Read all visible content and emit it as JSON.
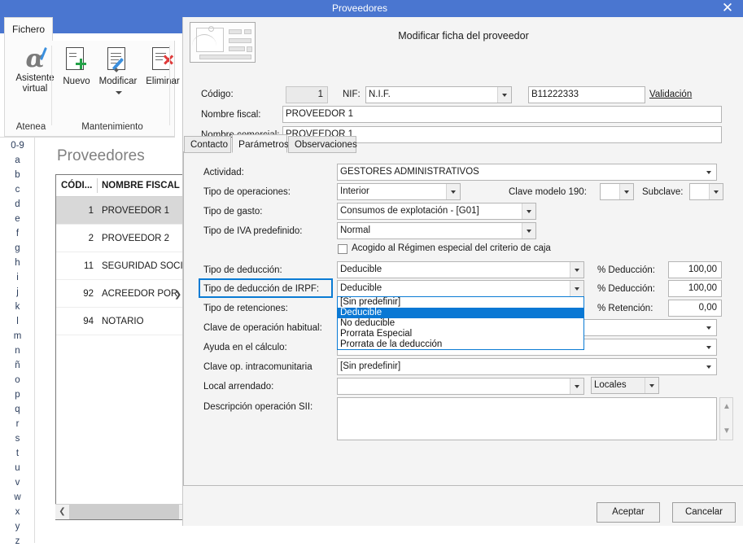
{
  "window": {
    "title": "Proveedores",
    "close_label": "✕"
  },
  "ribbon": {
    "tab_label": "Fichero",
    "buttons": [
      {
        "label_line1": "Asistente",
        "label_line2": "virtual",
        "icon": "alpha-pen-icon"
      },
      {
        "label": "Nuevo",
        "icon": "document-plus-icon"
      },
      {
        "label": "Modificar",
        "icon": "document-pencil-icon"
      },
      {
        "label": "Eliminar",
        "icon": "document-delete-icon"
      }
    ],
    "groups": [
      {
        "label": "Atenea"
      },
      {
        "label": "Mantenimiento"
      }
    ]
  },
  "alphabet_rail": {
    "items": [
      "0-9",
      "a",
      "b",
      "c",
      "d",
      "e",
      "f",
      "g",
      "h",
      "i",
      "j",
      "k",
      "l",
      "m",
      "n",
      "ñ",
      "o",
      "p",
      "q",
      "r",
      "s",
      "t",
      "u",
      "v",
      "w",
      "x",
      "y",
      "z"
    ]
  },
  "list_panel": {
    "title": "Proveedores",
    "columns": [
      "CÓDI...",
      "NOMBRE FISCAL"
    ],
    "rows": [
      {
        "code": "1",
        "name": "PROVEEDOR 1",
        "selected": true
      },
      {
        "code": "2",
        "name": "PROVEEDOR 2",
        "selected": false
      },
      {
        "code": "11",
        "name": "SEGURIDAD SOCI",
        "selected": false
      },
      {
        "code": "92",
        "name": "ACREEDOR POR ",
        "selected": false
      },
      {
        "code": "94",
        "name": "NOTARIO",
        "selected": false
      }
    ],
    "expander_icon": "chevron-right-icon",
    "hscroll_left_icon": "chevron-left-icon"
  },
  "dialog": {
    "icon": "id-card-icon",
    "title": "Modificar ficha del proveedor",
    "header": {
      "codigo_label": "Código:",
      "codigo_value": "1",
      "nif_label": "NIF:",
      "nif_type_value": "N.I.F.",
      "nif_value": "B11222333",
      "validacion_link": "Validación",
      "nombre_fiscal_label": "Nombre fiscal:",
      "nombre_fiscal_value": "PROVEEDOR 1",
      "nombre_comercial_label": "Nombre comercial:",
      "nombre_comercial_value": "PROVEEDOR 1"
    },
    "tabs": [
      {
        "label": "Contacto",
        "active": false
      },
      {
        "label": "Parámetros",
        "active": true
      },
      {
        "label": "Observaciones",
        "active": false
      }
    ],
    "fields": {
      "actividad_label": "Actividad:",
      "actividad_value": "GESTORES ADMINISTRATIVOS",
      "tipo_operaciones_label": "Tipo de operaciones:",
      "tipo_operaciones_value": "Interior",
      "clave_modelo_190_label": "Clave modelo 190:",
      "clave_modelo_190_value": "",
      "subclave_label": "Subclave:",
      "subclave_value": "",
      "tipo_gasto_label": "Tipo de gasto:",
      "tipo_gasto_value": "Consumos de explotación - [G01]",
      "tipo_iva_label": "Tipo de IVA predefinido:",
      "tipo_iva_value": "Normal",
      "criterio_caja_label": "Acogido al Régimen especial del criterio de caja",
      "criterio_caja_checked": false,
      "tipo_deduccion_label": "Tipo de deducción:",
      "tipo_deduccion_value": "Deducible",
      "pct_deduccion_label": "% Deducción:",
      "pct_deduccion_value": "100,00",
      "tipo_deduccion_irpf_label": "Tipo de deducción de IRPF:",
      "tipo_deduccion_irpf_value": "Deducible",
      "pct_deduccion_irpf_label": "% Deducción:",
      "pct_deduccion_irpf_value": "100,00",
      "tipo_retenciones_label": "Tipo de retenciones:",
      "tipo_retenciones_value": "",
      "pct_retencion_label": "% Retención:",
      "pct_retencion_value": "0,00",
      "clave_operacion_habitual_label": "Clave de operación habitual:",
      "clave_operacion_habitual_value": "",
      "ayuda_calculo_label": "Ayuda en el cálculo:",
      "ayuda_calculo_value": "",
      "clave_intracomunitaria_label": "Clave op. intracomunitaria",
      "clave_intracomunitaria_value": "[Sin predefinir]",
      "local_arrendado_label": "Local arrendado:",
      "local_arrendado_value": "",
      "locales_button_label": "Locales",
      "descripcion_sii_label": "Descripción operación SII:",
      "descripcion_sii_value": ""
    },
    "dropdown": {
      "open": true,
      "options": [
        {
          "label": "[Sin predefinir]",
          "selected": false
        },
        {
          "label": "Deducible",
          "selected": true
        },
        {
          "label": "No deducible",
          "selected": false
        },
        {
          "label": "Prorrata Especial",
          "selected": false
        },
        {
          "label": "Prorrata de la deducción",
          "selected": false
        }
      ]
    },
    "footer": {
      "accept_label": "Aceptar",
      "cancel_label": "Cancelar"
    }
  },
  "colors": {
    "titlebar": "#4a76d0",
    "accent_blue": "#0a78d4",
    "highlight_border": "#0a7bd4",
    "panel_bg": "#f4f4f4",
    "row_selected": "#d8d8d8"
  }
}
